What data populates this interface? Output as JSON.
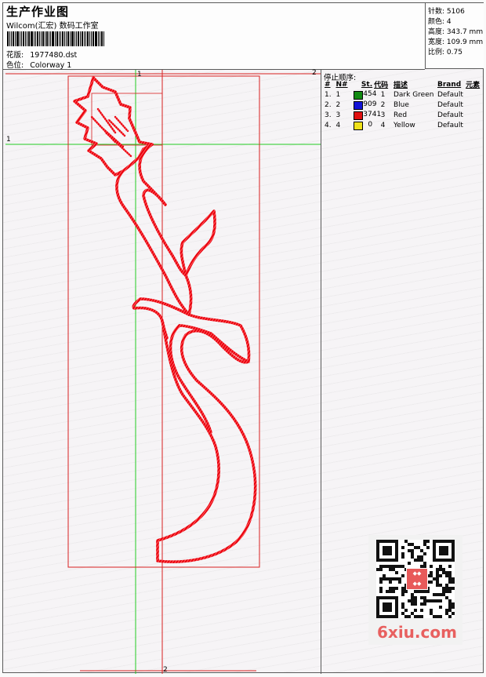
{
  "header": {
    "title": "生产作业图",
    "subtitle": "Wilcom(汇宏) 数码工作室",
    "design_label": "花版:",
    "design_value": "1977480.dst",
    "colorway_label": "色位:",
    "colorway_value": "Colorway 1"
  },
  "stats": {
    "stitches_label": "针数:",
    "stitches_value": "5106",
    "colors_label": "颜色:",
    "colors_value": "4",
    "height_label": "高度:",
    "height_value": "343.7 mm",
    "width_label": "宽度:",
    "width_value": "109.9 mm",
    "scale_label": "比例:",
    "scale_value": "0.75"
  },
  "stop_sequence": {
    "title": "停止顺序:",
    "columns": [
      "#",
      "N#",
      "St.",
      "代码",
      "描述",
      "Brand",
      "元素"
    ],
    "rows": [
      {
        "idx": "1.",
        "n": "1",
        "color": "#118a11",
        "st": "454",
        "code": "1",
        "desc": "Dark Green",
        "brand": "Default"
      },
      {
        "idx": "2.",
        "n": "2",
        "color": "#1313d6",
        "st": "909",
        "code": "2",
        "desc": "Blue",
        "brand": "Default"
      },
      {
        "idx": "3.",
        "n": "3",
        "color": "#e01010",
        "st": "3741",
        "code": "3",
        "desc": "Red",
        "brand": "Default"
      },
      {
        "idx": "4.",
        "n": "4",
        "color": "#f0e21a",
        "st": "0",
        "code": "4",
        "desc": "Yellow",
        "brand": "Default"
      }
    ]
  },
  "markers": {
    "top_right": "2",
    "top_center": "1",
    "left": "1",
    "bottom": "2"
  },
  "watermark": {
    "text": "6xiu.com"
  },
  "colors": {
    "embroidery": "#e8000e",
    "guide_red": "#d82020",
    "guide_green": "#22cc22",
    "watermark": "#e8605f"
  }
}
